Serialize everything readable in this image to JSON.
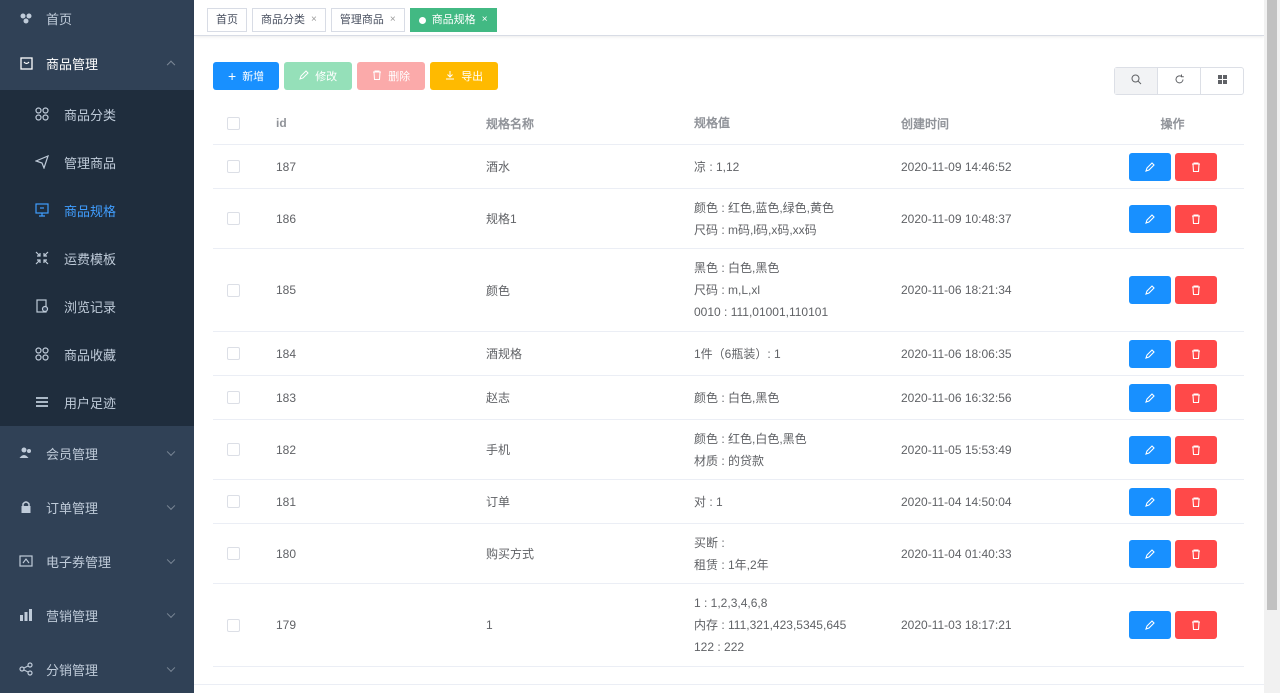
{
  "sidebar": {
    "home": {
      "label": "首页",
      "icon": "dashboard-icon"
    },
    "groups": [
      {
        "label": "商品管理",
        "icon": "shop-icon",
        "expanded": true
      },
      {
        "label": "会员管理",
        "icon": "peoples-icon"
      },
      {
        "label": "订单管理",
        "icon": "lock-icon"
      },
      {
        "label": "电子券管理",
        "icon": "coupon-icon"
      },
      {
        "label": "营销管理",
        "icon": "chart-icon"
      },
      {
        "label": "分销管理",
        "icon": "share-icon"
      }
    ],
    "sub_items": [
      {
        "label": "商品分类",
        "icon": "category-icon"
      },
      {
        "label": "管理商品",
        "icon": "send-icon"
      },
      {
        "label": "商品规格",
        "icon": "monitor-icon",
        "active": true
      },
      {
        "label": "运费模板",
        "icon": "shrink-icon"
      },
      {
        "label": "浏览记录",
        "icon": "log-icon"
      },
      {
        "label": "商品收藏",
        "icon": "collect-icon"
      },
      {
        "label": "用户足迹",
        "icon": "list-icon"
      }
    ]
  },
  "tags": [
    {
      "label": "首页",
      "closable": false
    },
    {
      "label": "商品分类",
      "closable": true
    },
    {
      "label": "管理商品",
      "closable": true
    },
    {
      "label": "商品规格",
      "closable": true,
      "active": true
    }
  ],
  "toolbar": {
    "add": "新增",
    "edit": "修改",
    "delete": "删除",
    "export": "导出"
  },
  "colors": {
    "sidebar_bg": "#304156",
    "submenu_bg": "#1f2d3d",
    "active_text": "#409eff",
    "tag_active": "#42b983",
    "primary": "#1890ff",
    "danger": "#ff4949",
    "warning": "#ffba00"
  },
  "table": {
    "headers": {
      "id": "id",
      "name": "规格名称",
      "value": "规格值",
      "time": "创建时间",
      "op": "操作"
    },
    "rows": [
      {
        "id": "187",
        "name": "酒水",
        "values": [
          "凉 : 1,12"
        ],
        "time": "2020-11-09 14:46:52"
      },
      {
        "id": "186",
        "name": "规格1",
        "values": [
          "颜色 : 红色,蓝色,绿色,黄色",
          "尺码 : m码,l码,x码,xx码"
        ],
        "time": "2020-11-09 10:48:37"
      },
      {
        "id": "185",
        "name": "颜色",
        "values": [
          "黑色 : 白色,黑色",
          "尺码 : m,L,xl",
          "0010 : 111,01001,110101"
        ],
        "time": "2020-11-06 18:21:34"
      },
      {
        "id": "184",
        "name": "酒规格",
        "values": [
          "1件（6瓶装）: 1"
        ],
        "time": "2020-11-06 18:06:35"
      },
      {
        "id": "183",
        "name": "赵志",
        "values": [
          "颜色 : 白色,黑色"
        ],
        "time": "2020-11-06 16:32:56"
      },
      {
        "id": "182",
        "name": "手机",
        "values": [
          "颜色 : 红色,白色,黑色",
          "材质 : 的贷款"
        ],
        "time": "2020-11-05 15:53:49"
      },
      {
        "id": "181",
        "name": "订单",
        "values": [
          "对 : 1"
        ],
        "time": "2020-11-04 14:50:04"
      },
      {
        "id": "180",
        "name": "购买方式",
        "values": [
          "买断 :",
          "租赁 : 1年,2年"
        ],
        "time": "2020-11-04 01:40:33"
      },
      {
        "id": "179",
        "name": "1",
        "values": [
          "1 : 1,2,3,4,6,8",
          "内存 : 111,321,423,5345,645",
          "122 : 222"
        ],
        "time": "2020-11-03 18:17:21"
      }
    ]
  }
}
